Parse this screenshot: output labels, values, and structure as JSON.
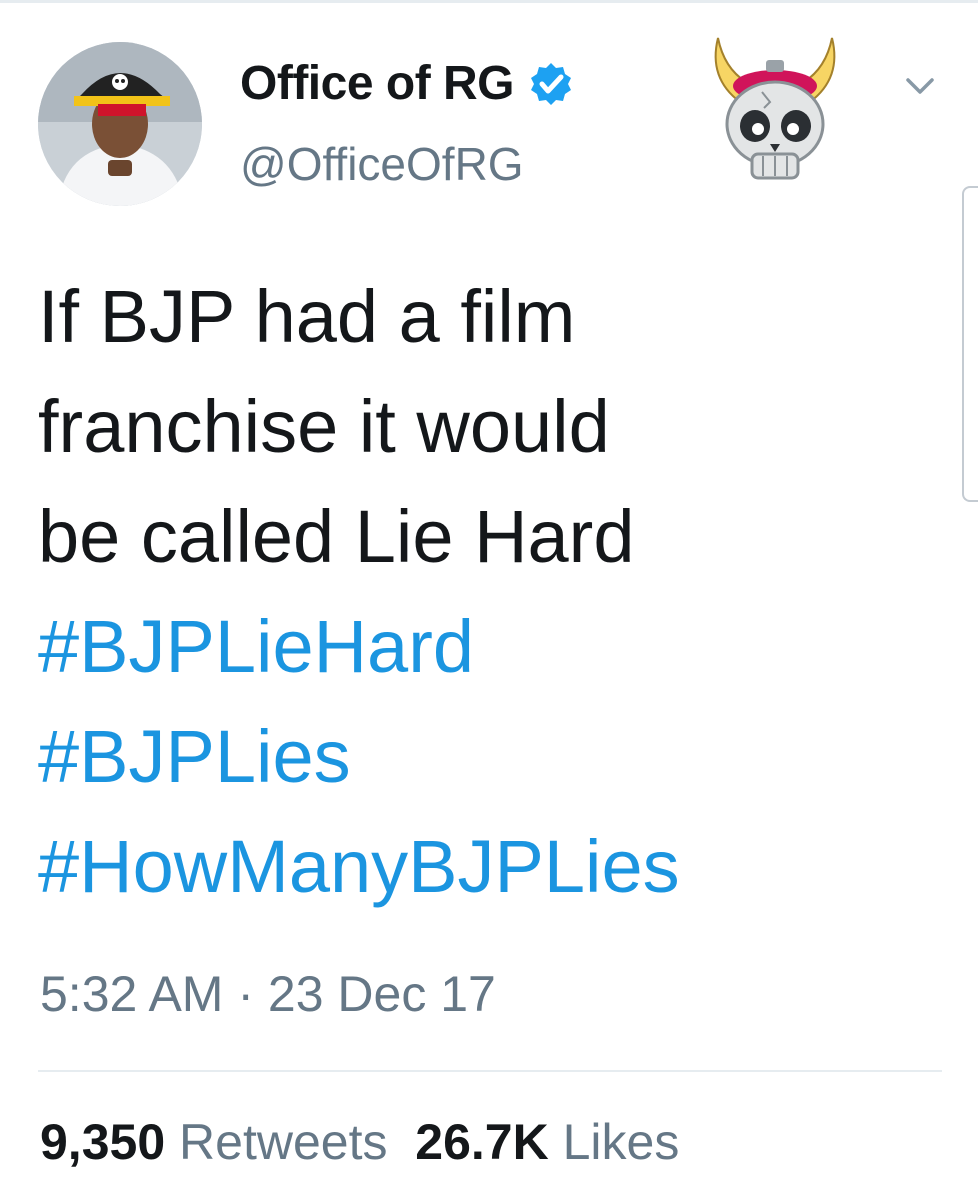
{
  "header": {
    "display_name": "Office of RG",
    "handle": "@OfficeOfRG",
    "verified": true,
    "icons": [
      "verified-badge-icon",
      "skull-viking-helmet-icon",
      "chevron-down-icon"
    ]
  },
  "tweet": {
    "lines": [
      "If BJP had a film",
      "franchise it would",
      "be called Lie Hard"
    ],
    "hashtags": [
      "#BJPLieHard",
      "#BJPLies",
      "#HowManyBJPLies"
    ]
  },
  "meta": {
    "time": "5:32 AM",
    "separator": "·",
    "date": "23 Dec 17"
  },
  "stats": {
    "retweets_count": "9,350",
    "retweets_label": "Retweets",
    "likes_count": "26.7K",
    "likes_label": "Likes"
  },
  "colors": {
    "link": "#1b95e0",
    "secondary_text": "#657786",
    "primary_text": "#14171a",
    "divider": "#e6ecf0",
    "verified": "#1da1f2"
  }
}
